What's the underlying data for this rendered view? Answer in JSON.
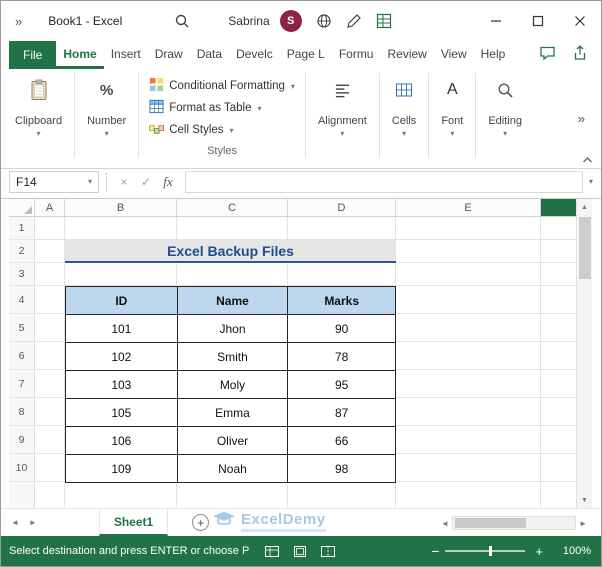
{
  "titlebar": {
    "overflow_chevron": "»",
    "title": "Book1 - Excel",
    "user_name": "Sabrina",
    "avatar_initial": "S"
  },
  "tabs": {
    "file": "File",
    "items": [
      "Home",
      "Insert",
      "Draw",
      "Data",
      "Develc",
      "Page L",
      "Formu",
      "Review",
      "View",
      "Help"
    ],
    "active_tab": "Home"
  },
  "ribbon": {
    "clipboard_label": "Clipboard",
    "number_label": "Number",
    "styles_label": "Styles",
    "styles_items": [
      "Conditional Formatting",
      "Format as Table",
      "Cell Styles"
    ],
    "alignment_label": "Alignment",
    "cells_label": "Cells",
    "font_label": "Font",
    "editing_label": "Editing"
  },
  "formula_bar": {
    "name_box": "F14",
    "formula_value": ""
  },
  "sheet": {
    "col_headers": [
      "A",
      "B",
      "C",
      "D",
      "E"
    ],
    "row_headers": [
      "1",
      "2",
      "3",
      "4",
      "5",
      "6",
      "7",
      "8",
      "9",
      "10"
    ],
    "title_cell": "Excel Backup Files",
    "table": {
      "headers": [
        "ID",
        "Name",
        "Marks"
      ],
      "rows": [
        [
          "101",
          "Jhon",
          "90"
        ],
        [
          "102",
          "Smith",
          "78"
        ],
        [
          "103",
          "Moly",
          "95"
        ],
        [
          "105",
          "Emma",
          "87"
        ],
        [
          "106",
          "Oliver",
          "66"
        ],
        [
          "109",
          "Noah",
          "98"
        ]
      ]
    }
  },
  "sheet_bar": {
    "tab": "Sheet1",
    "add": "+",
    "watermark": "ExcelDemy"
  },
  "status_bar": {
    "message": "Select destination and press ENTER or choose P",
    "zoom_out": "−",
    "zoom_in": "+",
    "zoom_level": "100%"
  },
  "icons": {
    "chevron_down": "▾",
    "more": "»",
    "cancel": "×",
    "enter": "✓",
    "fx": "fx",
    "percent": "%",
    "font_a": "A",
    "scroll_up": "▲",
    "scroll_down": "▼",
    "scroll_left": "◄",
    "scroll_right": "►"
  },
  "colors": {
    "excel_green": "#217346",
    "table_header_fill": "#BDD7EE",
    "title_text": "#1F4E8C",
    "avatar_bg": "#8E2345",
    "watermark_blue": "#9CC3E5"
  }
}
